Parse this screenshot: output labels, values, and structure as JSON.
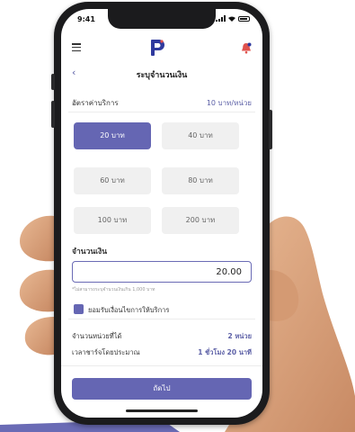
{
  "status": {
    "time": "9:41"
  },
  "header": {
    "title": "ระบุจำนวนเงิน",
    "back_icon": "‹"
  },
  "rate": {
    "label": "อัตราค่าบริการ",
    "value": "10 บาท/หน่วย"
  },
  "options": [
    "20 บาท",
    "40 บาท",
    "60 บาท",
    "80 บาท",
    "100 บาท",
    "200 บาท"
  ],
  "selected_option": "20 บาท",
  "amount": {
    "label": "จำนวนเงิน",
    "value": "20.00",
    "hint": "*ไม่สามารถระบุจำนวนเงินเกิน 1,000 บาท"
  },
  "consent": {
    "label": "ยอมรับเงื่อนไขการให้บริการ",
    "checked": true
  },
  "summary": {
    "units_label": "จำนวนหน่วยที่ได้",
    "units_value": "2 หน่วย",
    "time_label": "เวลาชาร์จโดยประมาณ",
    "time_value": "1 ชั่วโมง 20 นาที"
  },
  "next_label": "ถัดไป",
  "colors": {
    "accent": "#6566b3",
    "accent_text": "#5b5fa6",
    "logo_blue": "#2f3a9e",
    "bell": "#e0524d",
    "skin": "#d9a27e"
  },
  "icons": [
    "hamburger-icon",
    "logo-icon",
    "bell-icon",
    "back-icon",
    "checkbox-icon"
  ]
}
